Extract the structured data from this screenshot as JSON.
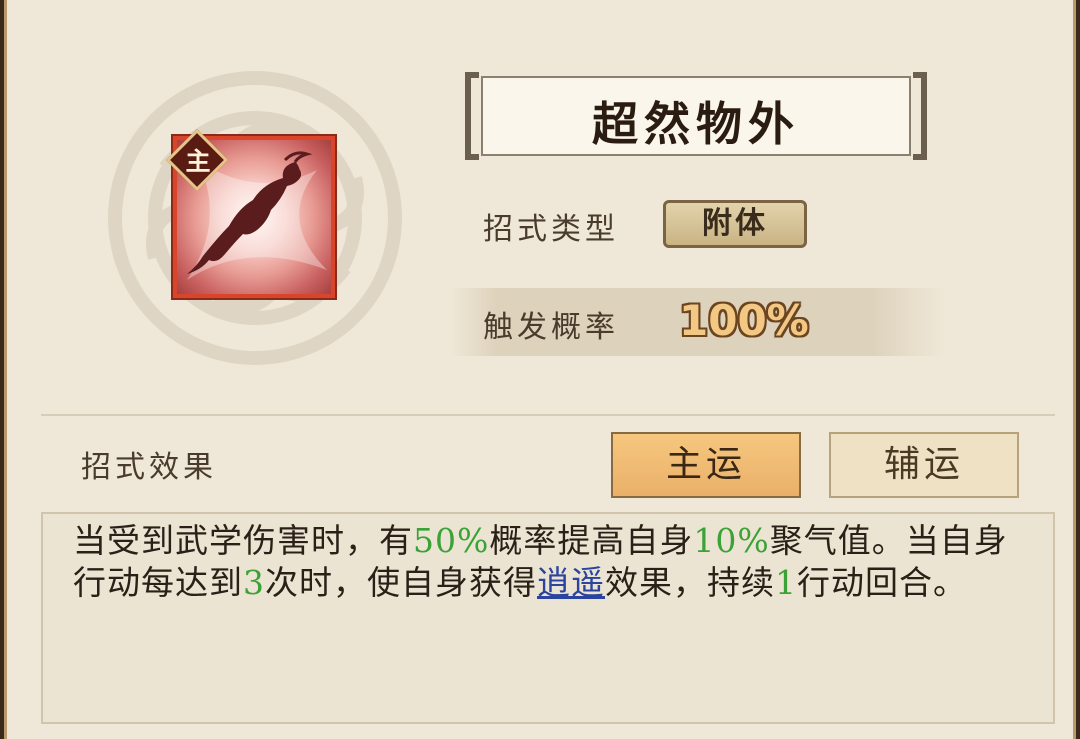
{
  "skill": {
    "name": "超然物外",
    "badge": "主",
    "icon": "floating-figure-icon"
  },
  "info": {
    "type_label": "招式类型",
    "type_value": "附体",
    "prob_label": "触发概率",
    "prob_value": "100%"
  },
  "effect": {
    "label": "招式效果",
    "tabs": [
      {
        "label": "主运",
        "active": true
      },
      {
        "label": "辅运",
        "active": false
      }
    ],
    "desc": {
      "p1": "当受到武学伤害时，有",
      "v1": "50%",
      "p2": "概率提高自身",
      "v2": "10%",
      "p3": "聚气值。当自身行动每达到",
      "v3": "3",
      "p4": "次时，使自身获得",
      "link": "逍遥",
      "p5": "效果，持续",
      "v4": "1",
      "p6": "行动回合。"
    }
  },
  "colors": {
    "highlight_green": "#3aa236",
    "link_blue": "#2a44a0",
    "active_tab": "#f0bc74"
  }
}
